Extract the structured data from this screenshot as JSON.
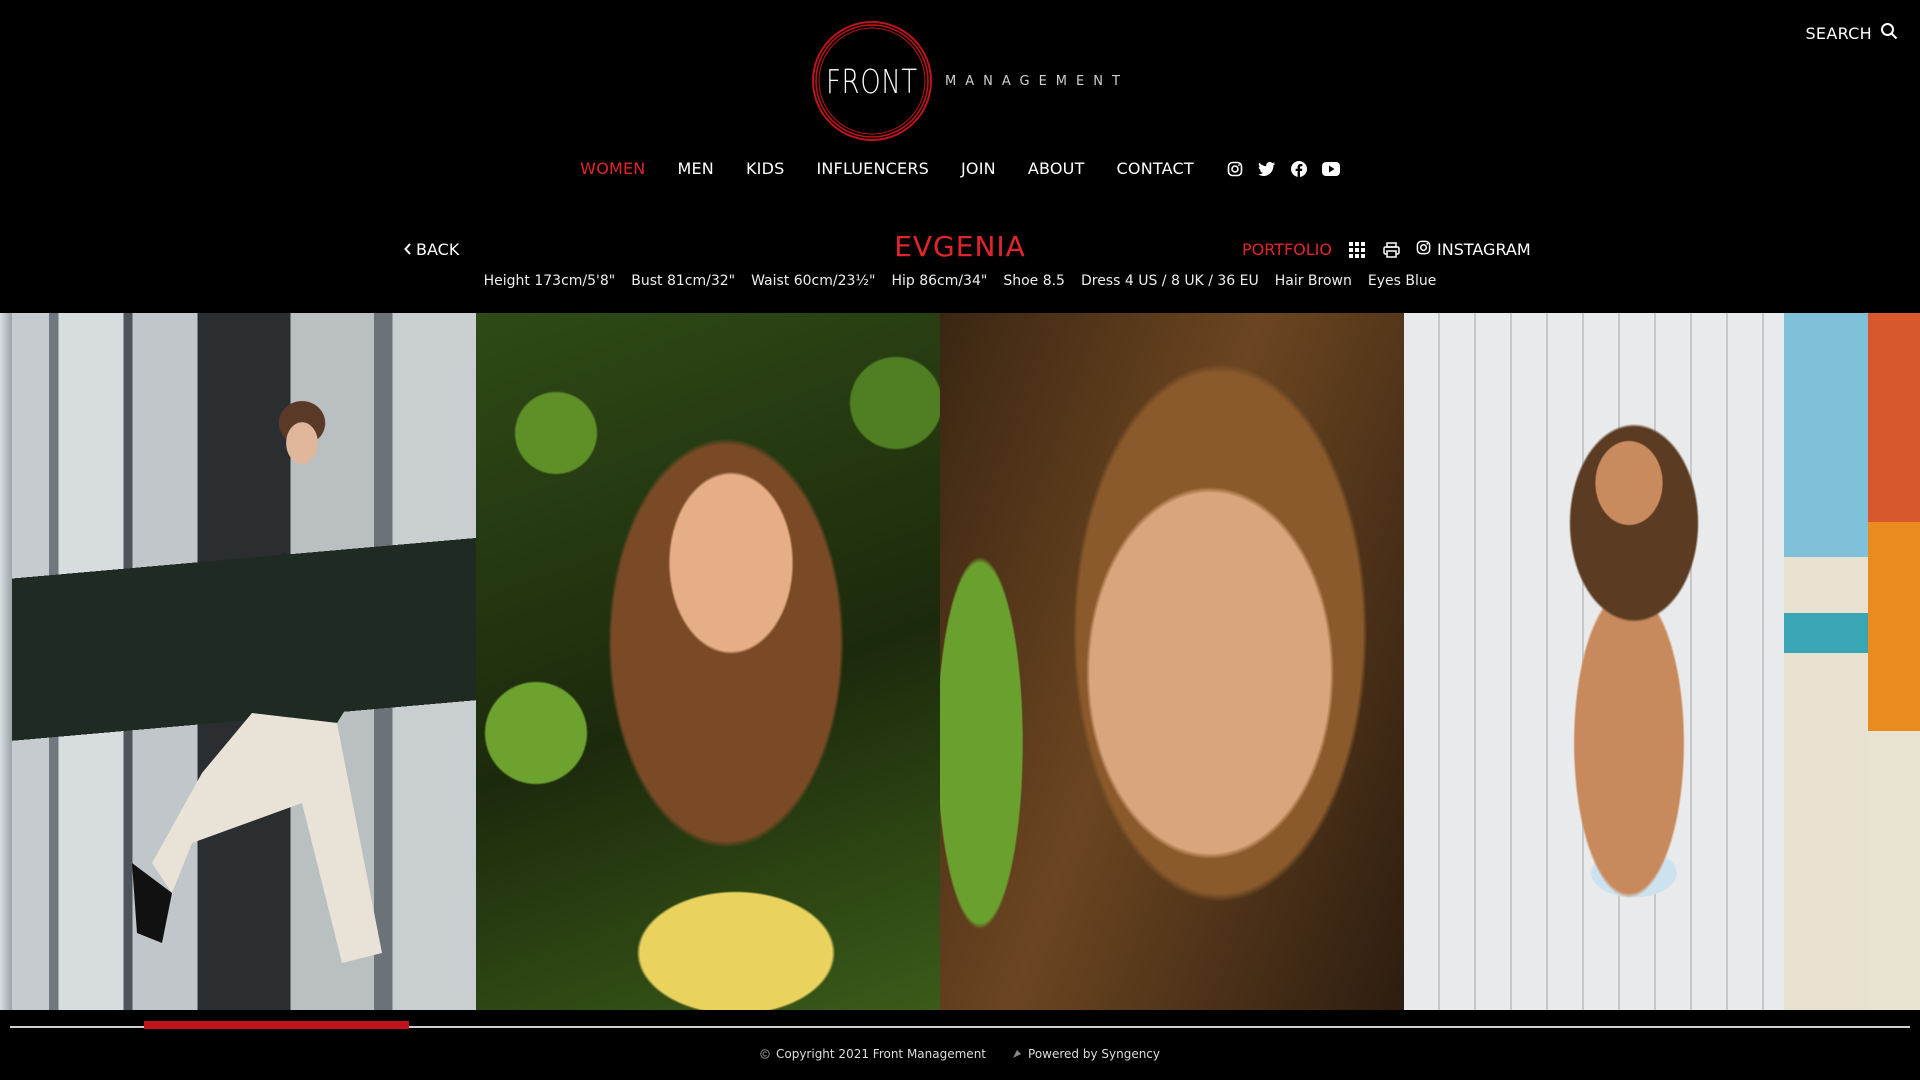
{
  "header": {
    "search_label": "SEARCH",
    "logo": {
      "front": "FRONT",
      "management": "MANAGEMENT"
    }
  },
  "nav": {
    "items": [
      {
        "label": "WOMEN",
        "active": true
      },
      {
        "label": "MEN"
      },
      {
        "label": "KIDS"
      },
      {
        "label": "INFLUENCERS"
      },
      {
        "label": "JOIN"
      },
      {
        "label": "ABOUT"
      },
      {
        "label": "CONTACT"
      }
    ],
    "social": [
      "instagram-icon",
      "twitter-icon",
      "facebook-icon",
      "youtube-icon"
    ]
  },
  "model": {
    "back_label": "BACK",
    "name": "EVGENIA",
    "portfolio_label": "PORTFOLIO",
    "instagram_label": "INSTAGRAM",
    "stats": [
      "Height 173cm/5'8\"",
      "Bust 81cm/32\"",
      "Waist 60cm/23½\"",
      "Hip 86cm/34\"",
      "Shoe 8.5",
      "Dress 4 US / 8 UK / 36 EU",
      "Hair Brown",
      "Eyes Blue"
    ]
  },
  "footer": {
    "copyright": "Copyright 2021 Front Management",
    "powered": "Powered by Syngency"
  },
  "colors": {
    "accent": "#e3242b",
    "background": "#000000",
    "scroll_thumb": "#c0141c"
  }
}
